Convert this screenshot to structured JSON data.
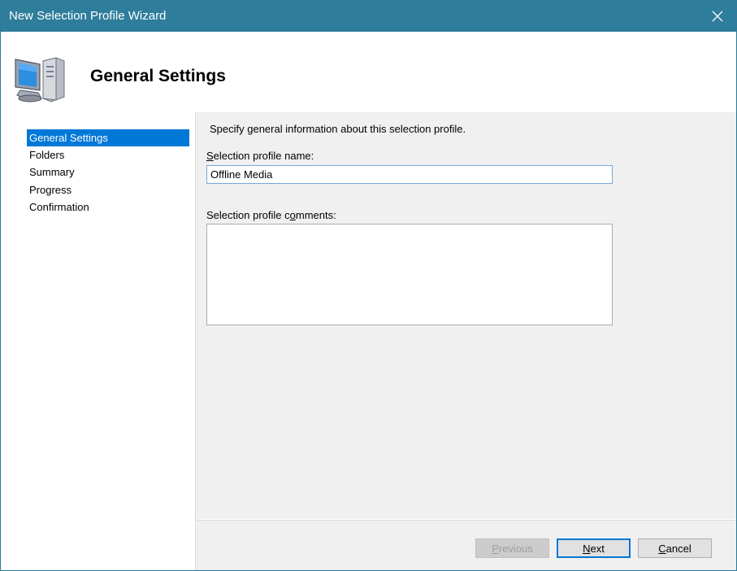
{
  "window": {
    "title": "New Selection Profile Wizard",
    "titlebar_color": "#2e7d9b"
  },
  "header": {
    "title": "General Settings",
    "icon": "computer-icon"
  },
  "nav": {
    "items": [
      {
        "label": "General Settings",
        "selected": true
      },
      {
        "label": "Folders",
        "selected": false
      },
      {
        "label": "Summary",
        "selected": false
      },
      {
        "label": "Progress",
        "selected": false
      },
      {
        "label": "Confirmation",
        "selected": false
      }
    ],
    "selected_color": "#0078d7"
  },
  "content": {
    "description": "Specify general information about this selection profile.",
    "name_label_prefix": "",
    "name_label_accel": "S",
    "name_label_rest": "election profile name:",
    "name_value": "Offline Media",
    "comments_label_prefix": "Selection profile c",
    "comments_label_accel": "o",
    "comments_label_rest": "mments:",
    "comments_value": ""
  },
  "buttons": {
    "previous_accel": "P",
    "previous_rest": "revious",
    "next_accel": "N",
    "next_rest": "ext",
    "cancel_accel": "C",
    "cancel_rest": "ancel"
  }
}
